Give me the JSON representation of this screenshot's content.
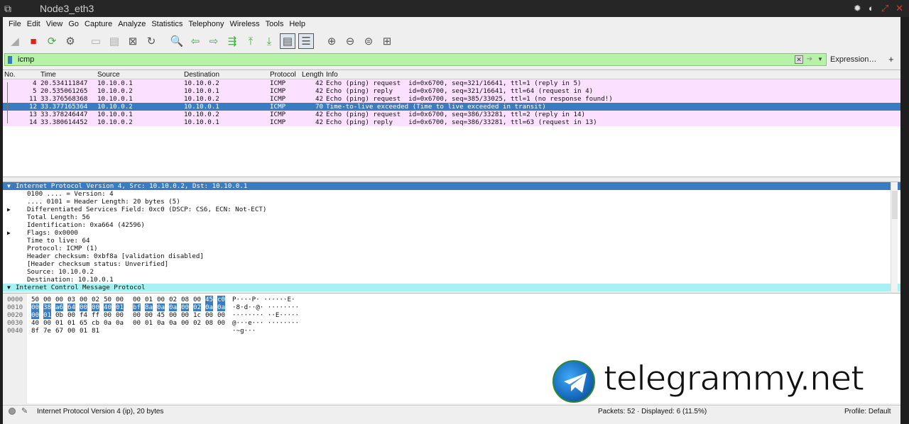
{
  "window_title": "Node3_eth3",
  "menu": [
    "File",
    "Edit",
    "View",
    "Go",
    "Capture",
    "Analyze",
    "Statistics",
    "Telephony",
    "Wireless",
    "Tools",
    "Help"
  ],
  "filter": {
    "value": "icmp",
    "expression_label": "Expression…",
    "plus_label": "+"
  },
  "packet_list": {
    "columns": [
      "No.",
      "Time",
      "Source",
      "Destination",
      "Protocol",
      "Length",
      "Info"
    ],
    "rows": [
      {
        "no": "4",
        "time": "20.534111847",
        "src": "10.10.0.1",
        "dst": "10.10.0.2",
        "proto": "ICMP",
        "len": "42",
        "info": "Echo (ping) request  id=0x6700, seq=321/16641, ttl=1 (reply in 5)"
      },
      {
        "no": "5",
        "time": "20.535061265",
        "src": "10.10.0.2",
        "dst": "10.10.0.1",
        "proto": "ICMP",
        "len": "42",
        "info": "Echo (ping) reply    id=0x6700, seq=321/16641, ttl=64 (request in 4)"
      },
      {
        "no": "11",
        "time": "33.376568368",
        "src": "10.10.0.1",
        "dst": "10.10.0.2",
        "proto": "ICMP",
        "len": "42",
        "info": "Echo (ping) request  id=0x6700, seq=385/33025, ttl=1 (no response found!)"
      },
      {
        "no": "12",
        "time": "33.377165364",
        "src": "10.10.0.2",
        "dst": "10.10.0.1",
        "proto": "ICMP",
        "len": "70",
        "info": "Time-to-live exceeded (Time to live exceeded in transit)"
      },
      {
        "no": "13",
        "time": "33.378246447",
        "src": "10.10.0.1",
        "dst": "10.10.0.2",
        "proto": "ICMP",
        "len": "42",
        "info": "Echo (ping) request  id=0x6700, seq=386/33281, ttl=2 (reply in 14)"
      },
      {
        "no": "14",
        "time": "33.380614452",
        "src": "10.10.0.2",
        "dst": "10.10.0.1",
        "proto": "ICMP",
        "len": "42",
        "info": "Echo (ping) reply    id=0x6700, seq=386/33281, ttl=63 (request in 13)"
      }
    ]
  },
  "details": [
    {
      "text": "Internet Protocol Version 4, Src: 10.10.0.2, Dst: 10.10.0.1",
      "expander": "▼"
    },
    {
      "text": "0100 .... = Version: 4",
      "expander": ""
    },
    {
      "text": ".... 0101 = Header Length: 20 bytes (5)",
      "expander": ""
    },
    {
      "text": "Differentiated Services Field: 0xc0 (DSCP: CS6, ECN: Not-ECT)",
      "expander": "▶"
    },
    {
      "text": "Total Length: 56",
      "expander": ""
    },
    {
      "text": "Identification: 0xa664 (42596)",
      "expander": ""
    },
    {
      "text": "Flags: 0x0000",
      "expander": "▶"
    },
    {
      "text": "Time to live: 64",
      "expander": ""
    },
    {
      "text": "Protocol: ICMP (1)",
      "expander": ""
    },
    {
      "text": "Header checksum: 0xbf8a [validation disabled]",
      "expander": ""
    },
    {
      "text": "[Header checksum status: Unverified]",
      "expander": ""
    },
    {
      "text": "Source: 10.10.0.2",
      "expander": ""
    },
    {
      "text": "Destination: 10.10.0.1",
      "expander": ""
    },
    {
      "text": "Internet Control Message Protocol",
      "expander": "▼"
    }
  ],
  "bytes": [
    {
      "offset": "0000",
      "hex": [
        "50",
        "00",
        "00",
        "03",
        "00",
        "02",
        "50",
        "00",
        "00",
        "01",
        "00",
        "02",
        "08",
        "00",
        "45",
        "c0"
      ],
      "ascii": "P····P· ······E·"
    },
    {
      "offset": "0010",
      "hex": [
        "00",
        "38",
        "a6",
        "64",
        "00",
        "00",
        "40",
        "01",
        "bf",
        "8a",
        "0a",
        "0a",
        "00",
        "02",
        "0a",
        "0a"
      ],
      "ascii": "·8·d··@· ········"
    },
    {
      "offset": "0020",
      "hex": [
        "00",
        "01",
        "0b",
        "00",
        "f4",
        "ff",
        "00",
        "00",
        "00",
        "00",
        "45",
        "00",
        "00",
        "1c",
        "00",
        "00"
      ],
      "ascii": "········ ··E·····"
    },
    {
      "offset": "0030",
      "hex": [
        "40",
        "00",
        "01",
        "01",
        "65",
        "cb",
        "0a",
        "0a",
        "00",
        "01",
        "0a",
        "0a",
        "00",
        "02",
        "08",
        "00"
      ],
      "ascii": "@···e··· ········"
    },
    {
      "offset": "0040",
      "hex": [
        "8f",
        "7e",
        "67",
        "00",
        "01",
        "81"
      ],
      "ascii": "·~g···"
    }
  ],
  "status": {
    "selected_field": "Internet Protocol Version 4 (ip), 20 bytes",
    "packets": "Packets: 52 · Displayed: 6 (11.5%)",
    "profile": "Profile: Default"
  },
  "watermark": "telegrammy.net"
}
